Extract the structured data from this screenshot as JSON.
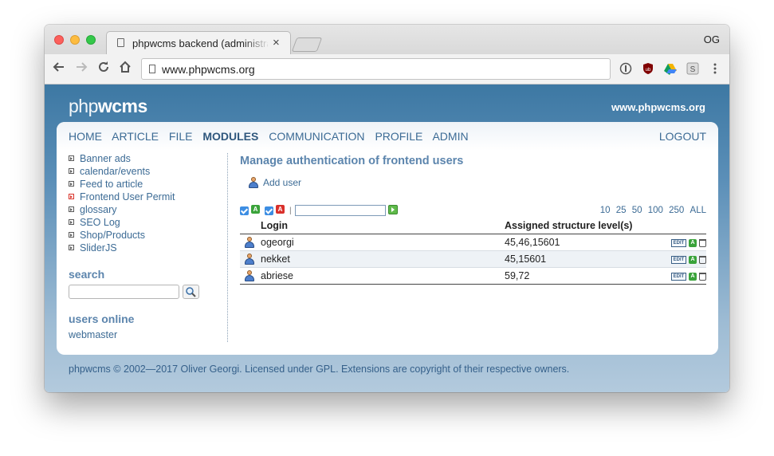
{
  "browser": {
    "tab_title": "phpwcms backend (administra",
    "tab_close": "×",
    "profile": "OG",
    "url": "www.phpwcms.org"
  },
  "header": {
    "logo_php": "php",
    "logo_wcms": "wcms",
    "site_link": "www.phpwcms.org"
  },
  "menu": {
    "items": [
      "HOME",
      "ARTICLE",
      "FILE",
      "MODULES",
      "COMMUNICATION",
      "PROFILE",
      "ADMIN"
    ],
    "active": "MODULES",
    "logout": "LOGOUT"
  },
  "sidebar": {
    "modules": [
      "Banner ads",
      "calendar/events",
      "Feed to article",
      "Frontend User Permit",
      "glossary",
      "SEO Log",
      "Shop/Products",
      "SliderJS"
    ],
    "selected": "Frontend User Permit",
    "search_heading": "search",
    "search_value": "",
    "online_heading": "users online",
    "online_users": [
      "webmaster"
    ]
  },
  "main": {
    "title": "Manage authentication of frontend users",
    "add_user": "Add user",
    "filter": {
      "active_tag": "A",
      "inactive_tag": "A",
      "separator": "|",
      "value": ""
    },
    "paging": [
      "10",
      "25",
      "50",
      "100",
      "250",
      "ALL"
    ],
    "columns": [
      "Login",
      "Assigned structure level(s)"
    ],
    "rows": [
      {
        "login": "ogeorgi",
        "levels": "45,46,15601"
      },
      {
        "login": "nekket",
        "levels": "45,15601"
      },
      {
        "login": "abriese",
        "levels": "59,72"
      }
    ],
    "row_actions": {
      "edit": "EDIT",
      "active": "A"
    }
  },
  "footer": "phpwcms © 2002—2017 Oliver Georgi. Licensed under GPL. Extensions are copyright of their respective owners.",
  "colors": {
    "header_blue": "#3d78a3",
    "link_blue": "#3c6b95",
    "heading_blue": "#5c85ad",
    "active_green": "#3aa33a",
    "inactive_red": "#d9302b"
  }
}
